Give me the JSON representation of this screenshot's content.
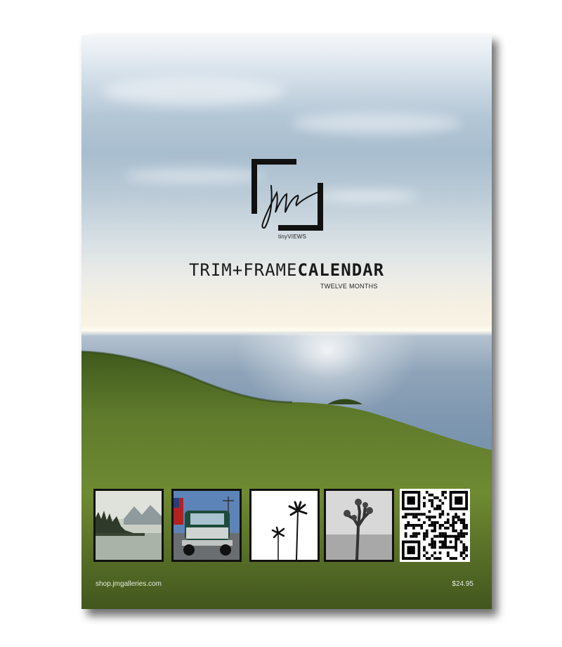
{
  "brand": {
    "logo_caption": "tinyVIEWS"
  },
  "title": {
    "part_light": "TRIM+FRAME",
    "part_bold": "CALENDAR",
    "subtitle": "TWELVE MONTHS"
  },
  "thumbnails": [
    {
      "subject": "lake with pine trees and mountains"
    },
    {
      "subject": "vintage green truck with flag"
    },
    {
      "subject": "palm tree silhouettes"
    },
    {
      "subject": "joshua tree black and white"
    },
    {
      "subject": "qr-code"
    }
  ],
  "footer": {
    "url": "shop.jmgalleries.com",
    "price": "$24.95"
  },
  "colors": {
    "grass": "#5e7a2a",
    "sea": "#7e97b0",
    "sky": "#a8bdce"
  }
}
